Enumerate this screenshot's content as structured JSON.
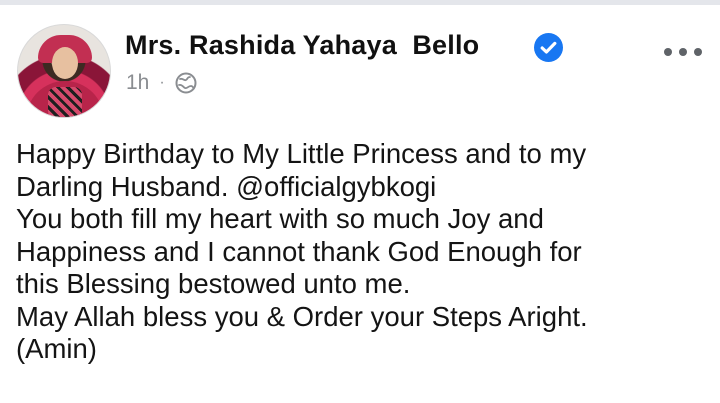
{
  "post": {
    "author": "Mrs. Rashida Yahaya  Bello",
    "time": "1h",
    "separator": "·",
    "audience_icon": "globe-icon",
    "verified_icon": "verified-badge-icon",
    "more_icon": "more-options-icon",
    "lines": [
      "Happy Birthday to My Little Princess and to my",
      "Darling Husband. @officialgybkogi",
      "You both fill my heart with so much Joy and",
      "Happiness and I cannot thank God Enough for",
      "this Blessing bestowed unto me.",
      "May Allah bless you & Order your Steps Aright.",
      "(Amin)"
    ]
  },
  "colors": {
    "verified": "#1877f2",
    "meta": "#8a8d91",
    "text": "#141414"
  }
}
